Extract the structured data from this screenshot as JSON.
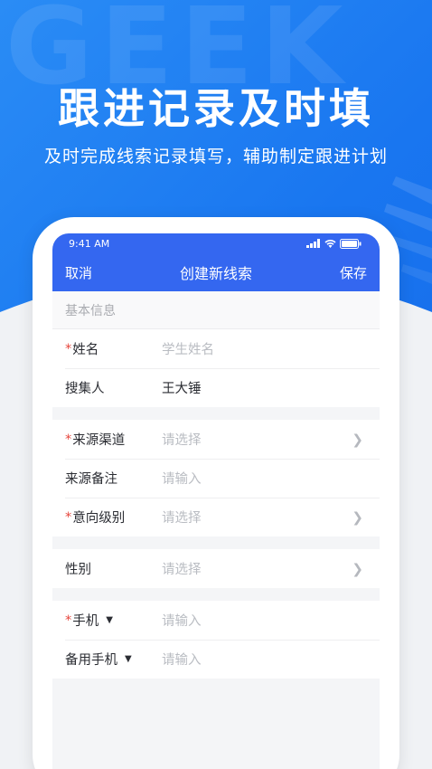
{
  "hero": {
    "watermark": "GEEK",
    "headline": "跟进记录及时填",
    "subline": "及时完成线索记录填写，辅助制定跟进计划"
  },
  "status": {
    "time": "9:41 AM"
  },
  "nav": {
    "cancel": "取消",
    "title": "创建新线索",
    "save": "保存"
  },
  "section": {
    "basic_info": "基本信息"
  },
  "fields": {
    "name": {
      "label": "姓名",
      "placeholder": "学生姓名",
      "required": "*"
    },
    "collector": {
      "label": "搜集人",
      "value": "王大锤"
    },
    "source_channel": {
      "label": "来源渠道",
      "placeholder": "请选择",
      "required": "*"
    },
    "source_note": {
      "label": "来源备注",
      "placeholder": "请输入"
    },
    "intent_level": {
      "label": "意向级别",
      "placeholder": "请选择",
      "required": "*"
    },
    "gender": {
      "label": "性别",
      "placeholder": "请选择"
    },
    "phone": {
      "label": "手机",
      "placeholder": "请输入",
      "required": "*"
    },
    "backup_phone": {
      "label": "备用手机",
      "placeholder": "请输入"
    }
  },
  "icons": {
    "chevron": "chevron-right-icon",
    "caret": "caret-down-icon"
  },
  "colors": {
    "brand_blue": "#3467f0",
    "hero_blue": "#1976f0",
    "required_red": "#e6453c"
  }
}
